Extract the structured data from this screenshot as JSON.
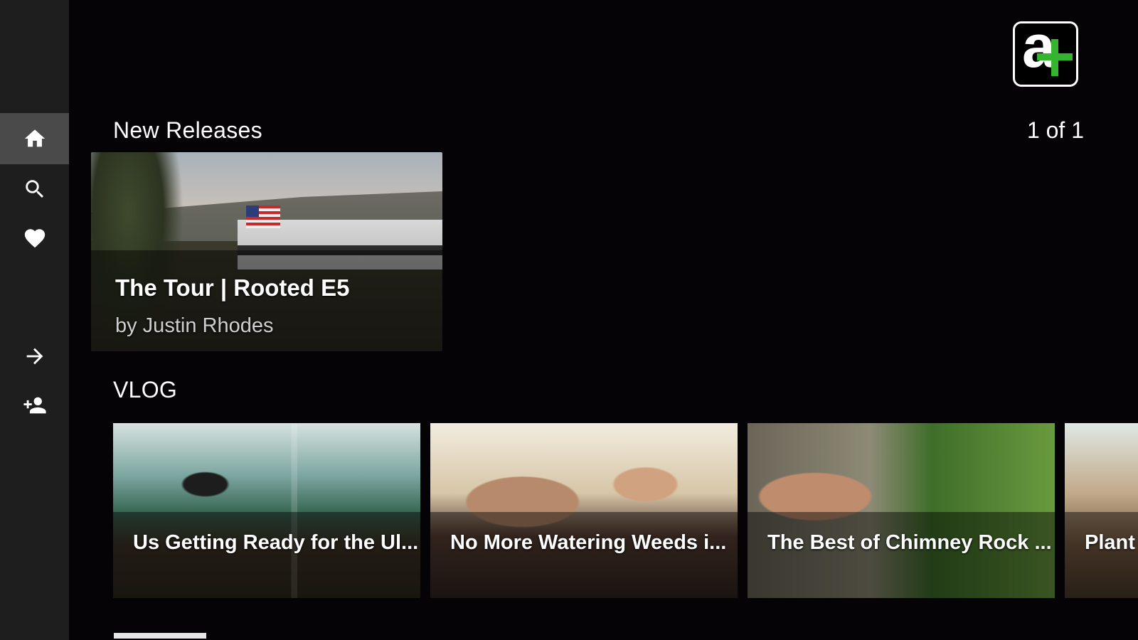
{
  "sidebar": {
    "items": [
      {
        "name": "home",
        "icon": "home-icon"
      },
      {
        "name": "search",
        "icon": "search-icon"
      },
      {
        "name": "favorites",
        "icon": "heart-icon"
      },
      {
        "name": "sign-in",
        "icon": "arrow-right-icon"
      },
      {
        "name": "add-account",
        "icon": "add-user-icon"
      }
    ]
  },
  "logo": {
    "brand_color": "#35b52f",
    "icon": "a-plus-logo"
  },
  "sections": {
    "new_releases": {
      "title": "New Releases",
      "page_indicator": "1 of 1",
      "feature": {
        "title": "The Tour | Rooted E5",
        "byline": "by Justin Rhodes"
      }
    },
    "vlog": {
      "title": "VLOG",
      "items": [
        {
          "title": "Us Getting Ready for the Ul..."
        },
        {
          "title": "No More Watering Weeds i..."
        },
        {
          "title": "The Best of Chimney Rock ..."
        },
        {
          "title": "Plant"
        }
      ]
    }
  }
}
